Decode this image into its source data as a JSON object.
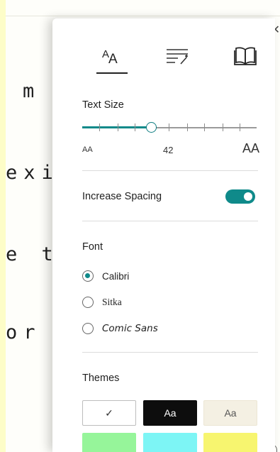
{
  "reader": {
    "lines": [
      "m",
      "exia",
      "e th",
      "or t"
    ]
  },
  "panel": {
    "tabs": [
      {
        "name": "text-preferences",
        "icon": "text-size-icon",
        "active": true
      },
      {
        "name": "grammar-options",
        "icon": "grammar-wand-icon",
        "active": false
      },
      {
        "name": "reading-preferences",
        "icon": "open-book-icon",
        "active": false
      }
    ],
    "text_size": {
      "label": "Text Size",
      "value": "42",
      "small_glyph": "AA",
      "large_glyph": "AA",
      "slider_fraction": 0.4
    },
    "spacing": {
      "label": "Increase Spacing",
      "enabled": true
    },
    "font": {
      "label": "Font",
      "options": [
        "Calibri",
        "Sitka",
        "Comic Sans"
      ],
      "selected": "Calibri"
    },
    "themes": {
      "label": "Themes",
      "swatch_text": "Aa",
      "check_glyph": "✓",
      "colors": [
        "#ffffff",
        "#0d0d0d",
        "#f4f0e3",
        "#96f59a",
        "#7df5f5",
        "#f7f56f"
      ]
    },
    "accent_color": "#0f8a8a"
  }
}
